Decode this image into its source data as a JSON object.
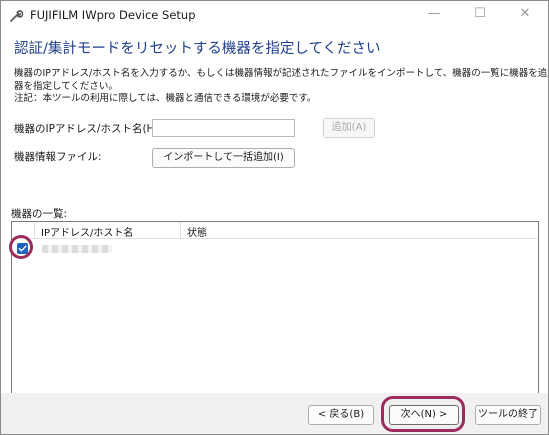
{
  "window": {
    "title": "FUJIFILM IWpro Device Setup",
    "controls": {
      "minimize": "—",
      "maximize": "☐",
      "close": "✕"
    }
  },
  "page": {
    "title": "認証/集計モードをリセットする機器を指定してください",
    "description": [
      "機器のIPアドレス/ホスト名を入力するか、もしくは機器情報が記述されたファイルをインポートして、機器の一覧に機器を追加し、対象の機",
      "器を指定してください。",
      "注記：本ツールの利用に際しては、機器と通信できる環境が必要です。"
    ]
  },
  "form": {
    "ip_label": "機器のIPアドレス/ホスト名(H):",
    "ip_value": "",
    "add_button": "追加(A)",
    "file_label": "機器情報ファイル:",
    "import_button": "インポートして一括追加(I)"
  },
  "device_list": {
    "label": "機器の一覧:",
    "columns": [
      "IPアドレス/ホスト名",
      "状態"
    ],
    "rows": [
      {
        "checked": true,
        "status": ""
      }
    ]
  },
  "footer": {
    "back_button": "< 戻る(B)",
    "next_button": "次へ(N) >",
    "exit_button": "ツールの終了"
  },
  "colors": {
    "title_blue": "#1f3f8f",
    "highlight": "#9b2c5e",
    "checkbox": "#1f63c2"
  }
}
